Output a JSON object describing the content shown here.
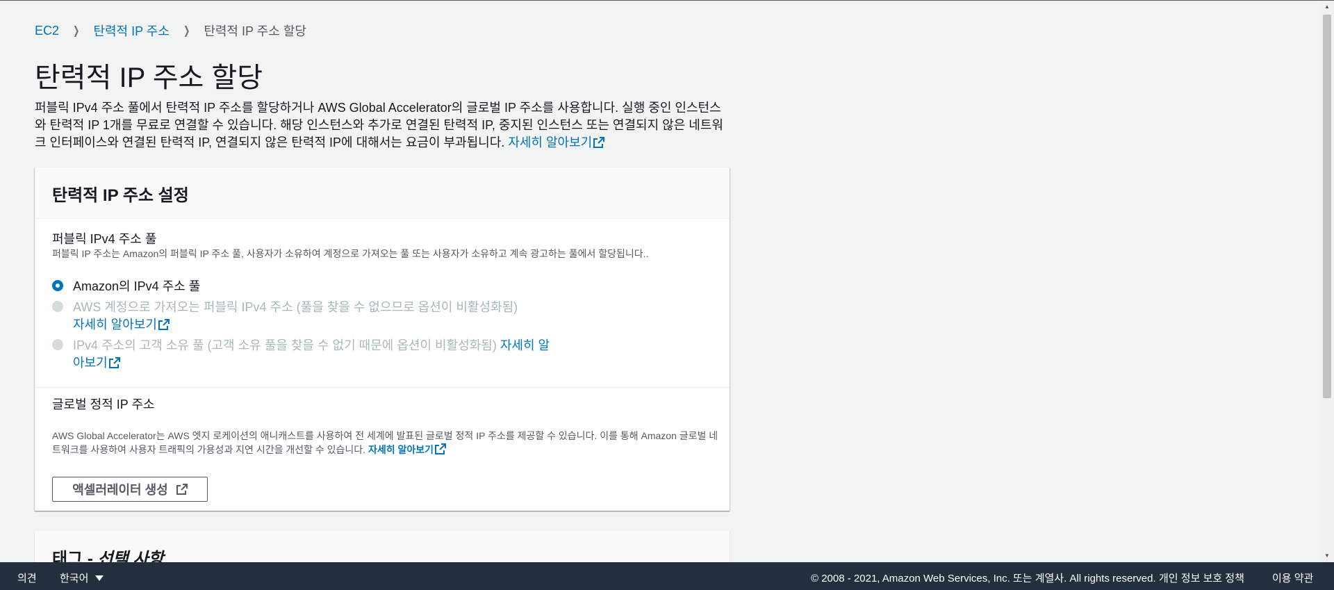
{
  "breadcrumb": {
    "items": [
      {
        "label": "EC2"
      },
      {
        "label": "탄력적 IP 주소"
      }
    ],
    "current": "탄력적 IP 주소 할당"
  },
  "page": {
    "title": "탄력적 IP 주소 할당",
    "description": "퍼블릭 IPv4 주소 풀에서 탄력적 IP 주소를 할당하거나 AWS Global Accelerator의 글로벌 IP 주소를 사용합니다. 실행 중인 인스턴스와 탄력적 IP 1개를 무료로 연결할 수 있습니다. 해당 인스턴스와 추가로 연결된 탄력적 IP, 중지된 인스턴스 또는 연결되지 않은 네트워크 인터페이스와 연결된 탄력적 IP, 연결되지 않은 탄력적 IP에 대해서는 요금이 부과됩니다. ",
    "learn_more": "자세히 알아보기"
  },
  "settings": {
    "title": "탄력적 IP 주소 설정",
    "pool": {
      "label": "퍼블릭 IPv4 주소 풀",
      "description": "퍼블릭 IP 주소는 Amazon의 퍼블릭 IP 주소 풀, 사용자가 소유하여 계정으로 가져오는 풀 또는 사용자가 소유하고 계속 광고하는 풀에서 할당됩니다..",
      "options": [
        {
          "label": "Amazon의 IPv4 주소 풀",
          "selected": true,
          "disabled": false
        },
        {
          "label": "AWS 계정으로 가져오는 퍼블릭 IPv4 주소 (풀을 찾을 수 없으므로 옵션이 비활성화됨) ",
          "link": "자세히 알아보기",
          "selected": false,
          "disabled": true
        },
        {
          "label": "IPv4 주소의 고객 소유 풀 (고객 소유 풀을 찾을 수 없기 때문에 옵션이 비활성화됨) ",
          "link": "자세히 알아보기",
          "selected": false,
          "disabled": true
        }
      ]
    },
    "global": {
      "label": "글로벌 정적 IP 주소",
      "description": "AWS Global Accelerator는 AWS 엣지 로케이션의 애니캐스트를 사용하여 전 세계에 발표된 글로벌 정적 IP 주소를 제공할 수 있습니다. 이를 통해 Amazon 글로벌 네트워크를 사용하여 사용자 트래픽의 가용성과 지연 시간을 개선할 수 있습니다. ",
      "learn_more": "자세히 알아보기",
      "button": "액셀러레이터 생성"
    }
  },
  "tags": {
    "title": "태그 - ",
    "optional": "선택 사항"
  },
  "footer": {
    "feedback": "의견",
    "language": "한국어",
    "copyright": "© 2008 - 2021, Amazon Web Services, Inc. 또는 계열사. All rights reserved.",
    "privacy": "개인 정보 보호 정책",
    "terms": "이용 약관"
  },
  "colors": {
    "link": "#0073bb",
    "footer_bg": "#232f3e",
    "page_bg": "#f2f3f3",
    "disabled": "#aab7b8"
  }
}
